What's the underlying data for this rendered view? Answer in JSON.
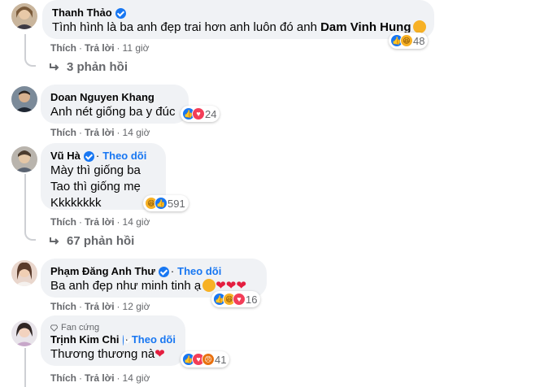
{
  "comments": [
    {
      "author": "Thanh Thảo",
      "verified": true,
      "text_main": "Tình hình là ba anh đẹp trai hơn anh luôn đó anh ",
      "mention": "Dam Vinh Hung",
      "reaction_count": "48",
      "reactions": [
        "like",
        "haha"
      ],
      "like_label": "Thích",
      "reply_label": "Trả lời",
      "time": "11 giờ",
      "replies_label": "3 phản hồi"
    },
    {
      "author": "Doan Nguyen Khang",
      "text": "Anh nét giống ba y đúc",
      "reaction_count": "24",
      "reactions": [
        "like",
        "love"
      ],
      "like_label": "Thích",
      "reply_label": "Trả lời",
      "time": "14 giờ"
    },
    {
      "author": "Vũ Hà",
      "verified": true,
      "follow_label": "Theo dõi",
      "lines": [
        "Mày thì giống ba",
        "Tao thì giống mẹ",
        "Kkkkkkkk"
      ],
      "reaction_count": "591",
      "reactions": [
        "haha",
        "like"
      ],
      "like_label": "Thích",
      "reply_label": "Trả lời",
      "time": "14 giờ",
      "replies_label": "67 phản hồi"
    },
    {
      "author": "Phạm Đăng Anh Thư",
      "verified": true,
      "follow_label": "Theo dõi",
      "text": "Ba anh đẹp như minh tinh ạ",
      "reaction_count": "16",
      "reactions": [
        "like",
        "haha",
        "love"
      ],
      "like_label": "Thích",
      "reply_label": "Trả lời",
      "time": "12 giờ"
    },
    {
      "author": "Trịnh Kim Chi",
      "badge": "Fan cứng",
      "verified": true,
      "follow_label": "Theo dõi",
      "text": "Thương thương nà",
      "reaction_count": "41",
      "reactions": [
        "like",
        "love",
        "angry"
      ],
      "like_label": "Thích",
      "reply_label": "Trả lời",
      "time": "14 giờ"
    }
  ],
  "colors": {
    "bubble": "#f0f2f5",
    "meta": "#65676b",
    "link": "#1877f2",
    "verified": "#1877f2",
    "heart": "#e41e3f"
  },
  "icons": {
    "like": "like-icon",
    "haha": "haha-icon",
    "love": "love-icon",
    "care": "care-icon",
    "angry": "angry-icon",
    "verified": "verified-badge-icon",
    "reply": "reply-arrow-icon",
    "fan": "diamond-icon"
  }
}
